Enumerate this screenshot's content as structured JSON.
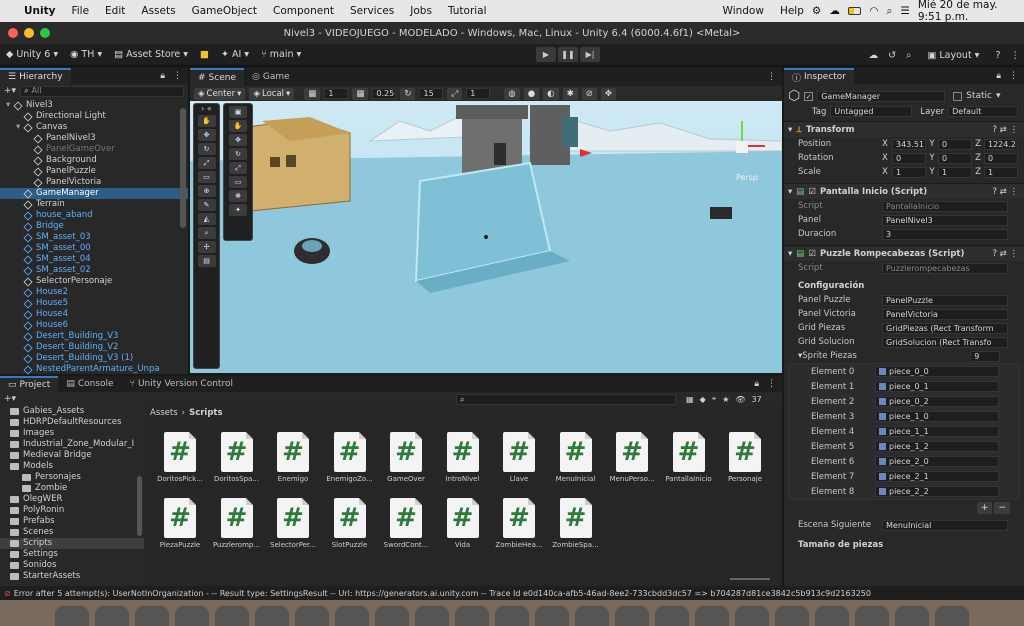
{
  "menubar": {
    "app": "Unity",
    "items": [
      "File",
      "Edit",
      "Assets",
      "GameObject",
      "Component",
      "Services",
      "Jobs",
      "Tutorial",
      "Window",
      "Help"
    ],
    "clock": "Mié 20 de may.  9:51 p.m."
  },
  "title": "Nivel3 - VIDEOJUEGO - MODELADO - Windows, Mac, Linux - Unity 6.4 (6000.4.6f1) <Metal>",
  "toolbar": {
    "unity": "Unity 6",
    "account": "TH",
    "asset_store": "Asset Store",
    "ai": "AI",
    "branch": "main",
    "layout": "Layout"
  },
  "hierarchy": {
    "tab": "Hierarchy",
    "search_placeholder": "All",
    "rows": [
      {
        "label": "Nivel3",
        "indent": 0,
        "blue": false,
        "sel": false
      },
      {
        "label": "Directional Light",
        "indent": 1,
        "blue": false,
        "sel": false
      },
      {
        "label": "Canvas",
        "indent": 1,
        "blue": false,
        "sel": false
      },
      {
        "label": "PanelNivel3",
        "indent": 2,
        "blue": false,
        "sel": false
      },
      {
        "label": "PanelGameOver",
        "indent": 2,
        "blue": false,
        "sel": false,
        "dim": true
      },
      {
        "label": "Background",
        "indent": 2,
        "blue": false,
        "sel": false
      },
      {
        "label": "PanelPuzzle",
        "indent": 2,
        "blue": false,
        "sel": false
      },
      {
        "label": "PanelVictoria",
        "indent": 2,
        "blue": false,
        "sel": false
      },
      {
        "label": "GameManager",
        "indent": 1,
        "blue": false,
        "sel": true
      },
      {
        "label": "Terrain",
        "indent": 1,
        "blue": false,
        "sel": false
      },
      {
        "label": "house_aband",
        "indent": 1,
        "blue": true,
        "sel": false
      },
      {
        "label": "Bridge",
        "indent": 1,
        "blue": true,
        "sel": false
      },
      {
        "label": "SM_asset_03",
        "indent": 1,
        "blue": true,
        "sel": false
      },
      {
        "label": "SM_asset_00",
        "indent": 1,
        "blue": true,
        "sel": false
      },
      {
        "label": "SM_asset_04",
        "indent": 1,
        "blue": true,
        "sel": false
      },
      {
        "label": "SM_asset_02",
        "indent": 1,
        "blue": true,
        "sel": false
      },
      {
        "label": "SelectorPersonaje",
        "indent": 1,
        "blue": false,
        "sel": false
      },
      {
        "label": "House2",
        "indent": 1,
        "blue": true,
        "sel": false
      },
      {
        "label": "House5",
        "indent": 1,
        "blue": true,
        "sel": false
      },
      {
        "label": "House4",
        "indent": 1,
        "blue": true,
        "sel": false
      },
      {
        "label": "House6",
        "indent": 1,
        "blue": true,
        "sel": false
      },
      {
        "label": "Desert_Building_V3",
        "indent": 1,
        "blue": true,
        "sel": false
      },
      {
        "label": "Desert_Building_V2",
        "indent": 1,
        "blue": true,
        "sel": false
      },
      {
        "label": "Desert_Building_V3 (1)",
        "indent": 1,
        "blue": true,
        "sel": false
      },
      {
        "label": "NestedParentArmature_Unpa",
        "indent": 1,
        "blue": true,
        "sel": false
      }
    ]
  },
  "scene": {
    "tabs": [
      "Scene",
      "Game"
    ],
    "pivot": "Center",
    "space": "Local",
    "grid": "1",
    "snap": "0.25",
    "angle": "15",
    "scale": "1",
    "persp": "Persp"
  },
  "inspector": {
    "tab": "Inspector",
    "object_name": "GameManager",
    "static": "Static",
    "tag_label": "Tag",
    "tag": "Untagged",
    "layer_label": "Layer",
    "layer": "Default",
    "transform": {
      "title": "Transform",
      "position_label": "Position",
      "rotation_label": "Rotation",
      "scale_label": "Scale",
      "position": [
        "343.51",
        "0",
        "1224.2"
      ],
      "rotation": [
        "0",
        "0",
        "0"
      ],
      "scale": [
        "1",
        "1",
        "1"
      ]
    },
    "pantalla": {
      "title": "Pantalla Inicio (Script)",
      "script_label": "Script",
      "script": "PantallaInicio",
      "panel_label": "Panel",
      "panel": "PanelNivel3",
      "duracion_label": "Duracion",
      "duracion": "3"
    },
    "puzzle": {
      "title": "Puzzle Rompecabezas (Script)",
      "script_label": "Script",
      "script": "Puzzlerompecabezas",
      "config": "Configuración",
      "fields": [
        {
          "label": "Panel Puzzle",
          "value": "PanelPuzzle"
        },
        {
          "label": "Panel Victoria",
          "value": "PanelVictoria"
        },
        {
          "label": "Grid Piezas",
          "value": "GridPiezas (Rect Transform"
        },
        {
          "label": "Grid Solucion",
          "value": "GridSolucion (Rect Transfo"
        }
      ],
      "sprite_label": "Sprite Piezas",
      "sprite_count": "9",
      "elements": [
        {
          "label": "Element 0",
          "value": "piece_0_0"
        },
        {
          "label": "Element 1",
          "value": "piece_0_1"
        },
        {
          "label": "Element 2",
          "value": "piece_0_2"
        },
        {
          "label": "Element 3",
          "value": "piece_1_0"
        },
        {
          "label": "Element 4",
          "value": "piece_1_1"
        },
        {
          "label": "Element 5",
          "value": "piece_1_2"
        },
        {
          "label": "Element 6",
          "value": "piece_2_0"
        },
        {
          "label": "Element 7",
          "value": "piece_2_1"
        },
        {
          "label": "Element 8",
          "value": "piece_2_2"
        }
      ],
      "escena_label": "Escena Siguiente",
      "escena": "MenuInicial",
      "tamano": "Tamaño de piezas"
    }
  },
  "project": {
    "tabs": [
      "Project",
      "Console",
      "Unity Version Control"
    ],
    "folders": [
      "Gabies_Assets",
      "HDRPDefaultResources",
      "Images",
      "Industrial_Zone_Modular_I",
      "Medieval Bridge",
      "Models",
      "Personajes",
      "Zombie",
      "OlegWER",
      "PolyRonin",
      "Prefabs",
      "Scenes",
      "Scripts",
      "Settings",
      "Sonidos",
      "StarterAssets"
    ],
    "breadcrumb": [
      "Assets",
      "Scripts"
    ],
    "count": "37",
    "files": [
      "DoritosPick...",
      "DoritosSpa...",
      "Enemigo",
      "EnemigoZo...",
      "GameOver",
      "IntroNivel",
      "Llave",
      "MenuInicial",
      "MenuPerso...",
      "PantallaInicio",
      "Personaje",
      "PiezaPuzzle",
      "Puzzleromp...",
      "SelectorPer...",
      "SlotPuzzle",
      "SwordCont...",
      "Vida",
      "ZombieHea...",
      "ZombieSpa..."
    ]
  },
  "status": "Error after 5 attempt(s): UserNotInOrganization -  -- Result type: SettingsResult -- Url: https://generators.ai.unity.com -- Trace Id e0d140ca-afb5-46ad-8ee2-733cbdd3dc57 => b704287d81ce3842c5b913c9d2163250"
}
